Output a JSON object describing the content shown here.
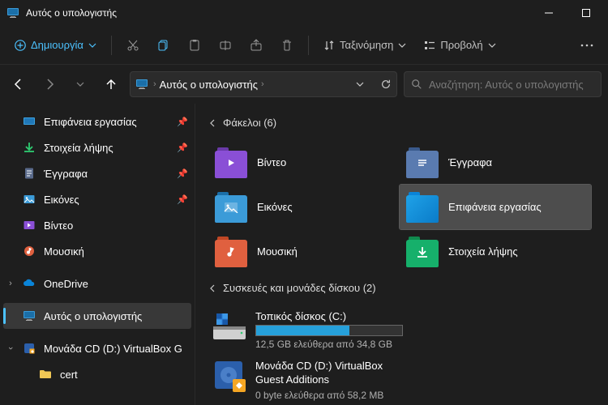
{
  "titlebar": {
    "title": "Αυτός ο υπολογιστής"
  },
  "toolbar": {
    "new_label": "Δημιουργία",
    "sort_label": "Ταξινόμηση",
    "view_label": "Προβολή"
  },
  "breadcrumb": {
    "location": "Αυτός ο υπολογιστής"
  },
  "search": {
    "placeholder": "Αναζήτηση: Αυτός ο υπολογιστής"
  },
  "sidebar": {
    "items": [
      {
        "label": "Επιφάνεια εργασίας",
        "pinned": true
      },
      {
        "label": "Στοιχεία λήψης",
        "pinned": true
      },
      {
        "label": "Έγγραφα",
        "pinned": true
      },
      {
        "label": "Εικόνες",
        "pinned": true
      },
      {
        "label": "Βίντεο"
      },
      {
        "label": "Μουσική"
      }
    ],
    "onedrive": "OneDrive",
    "thispc": "Αυτός ο υπολογιστής",
    "cd": "Μονάδα CD (D:) VirtualBox G",
    "cert": "cert"
  },
  "groups": {
    "folders_header": "Φάκελοι (6)",
    "drives_header": "Συσκευές και μονάδες δίσκου (2)",
    "folders": [
      {
        "label": "Βίντεο"
      },
      {
        "label": "Έγγραφα"
      },
      {
        "label": "Εικόνες"
      },
      {
        "label": "Επιφάνεια εργασίας"
      },
      {
        "label": "Μουσική"
      },
      {
        "label": "Στοιχεία λήψης"
      }
    ],
    "drives": [
      {
        "name": "Τοπικός δίσκος (C:)",
        "free": "12,5 GB ελεύθερα από 34,8 GB",
        "fill_pct": 64
      },
      {
        "name": "Μονάδα CD (D:) VirtualBox Guest Additions",
        "free": "0 byte ελεύθερα από 58,2 MB"
      }
    ]
  }
}
